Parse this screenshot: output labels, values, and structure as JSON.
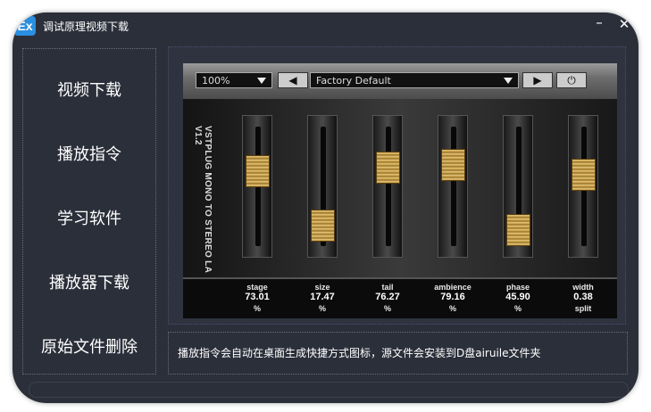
{
  "window": {
    "app_icon_text": "Ex",
    "title": "调试原理视频下载",
    "minimize_glyph": "–",
    "close_glyph": "✕"
  },
  "sidebar": {
    "items": [
      {
        "label": "视频下载"
      },
      {
        "label": "播放指令"
      },
      {
        "label": "学习软件"
      },
      {
        "label": "播放器下载"
      },
      {
        "label": "原始文件删除"
      }
    ]
  },
  "plugin": {
    "zoom": "100%",
    "prev_glyph": "◀",
    "preset": "Factory Default",
    "next_glyph": "▶",
    "power_glyph": "⏻",
    "name": "VSTPLUG MONO TO STEREO LA V1.2",
    "params": [
      {
        "label": "stage",
        "value": "73.01",
        "unit": "%",
        "level": 0.73
      },
      {
        "label": "size",
        "value": "17.47",
        "unit": "%",
        "level": 0.17
      },
      {
        "label": "tail",
        "value": "76.27",
        "unit": "%",
        "level": 0.76
      },
      {
        "label": "ambience",
        "value": "79.16",
        "unit": "%",
        "level": 0.79
      },
      {
        "label": "phase",
        "value": "45.90",
        "unit": "%",
        "level": 0.13
      },
      {
        "label": "width",
        "value": "0.38",
        "unit": "split",
        "level": 0.69
      }
    ]
  },
  "status": {
    "text": "播放指令会自动在桌面生成快捷方式图标，源文件会安装到D盘airuile文件夹"
  },
  "colors": {
    "window_bg": "#2b2f3a",
    "app_icon_bg": "#2a8fe0",
    "knob_gold": "#c79f45"
  },
  "icons": [
    "app-logo-icon",
    "arrow-left-icon",
    "arrow-right-icon",
    "power-icon",
    "hand-cursor-icon"
  ]
}
